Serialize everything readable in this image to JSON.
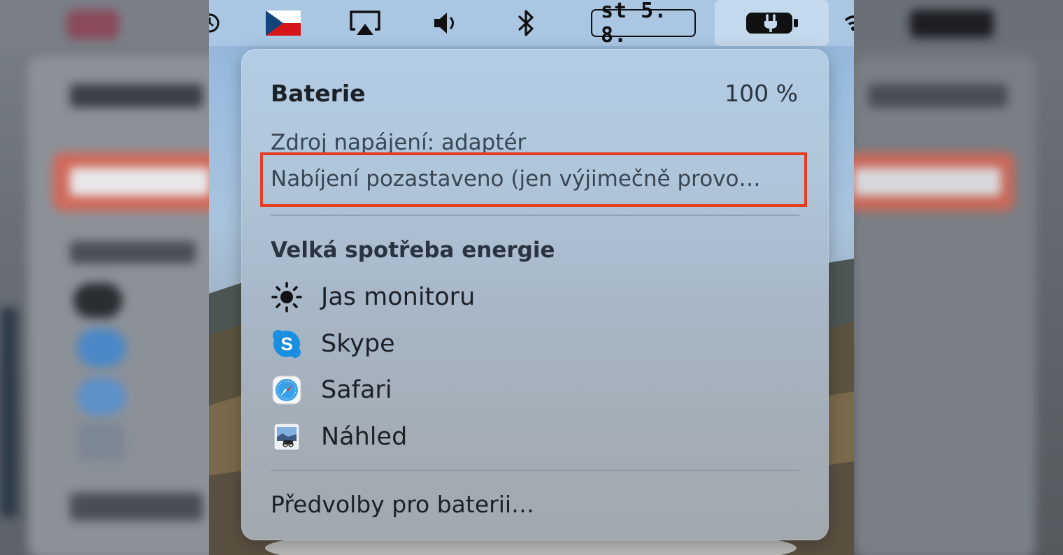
{
  "menubar": {
    "date": "st 5. 8.",
    "icons": [
      "czech-flag-icon",
      "airplay-icon",
      "volume-icon",
      "bluetooth-icon",
      "battery-charging-icon",
      "wifi-icon"
    ]
  },
  "battery_menu": {
    "title": "Baterie",
    "percent": "100 %",
    "power_source": "Zdroj napájení: adaptér",
    "charging_status": "Nabíjení pozastaveno (jen výjimečně provo…",
    "highlight_color": "#e43d24",
    "section_title": "Velká spotřeba energie",
    "apps": [
      {
        "name": "Jas monitoru",
        "icon": "brightness-icon"
      },
      {
        "name": "Skype",
        "icon": "skype-icon"
      },
      {
        "name": "Safari",
        "icon": "safari-icon"
      },
      {
        "name": "Náhled",
        "icon": "preview-icon"
      }
    ],
    "preferences": "Předvolby pro baterii…"
  }
}
